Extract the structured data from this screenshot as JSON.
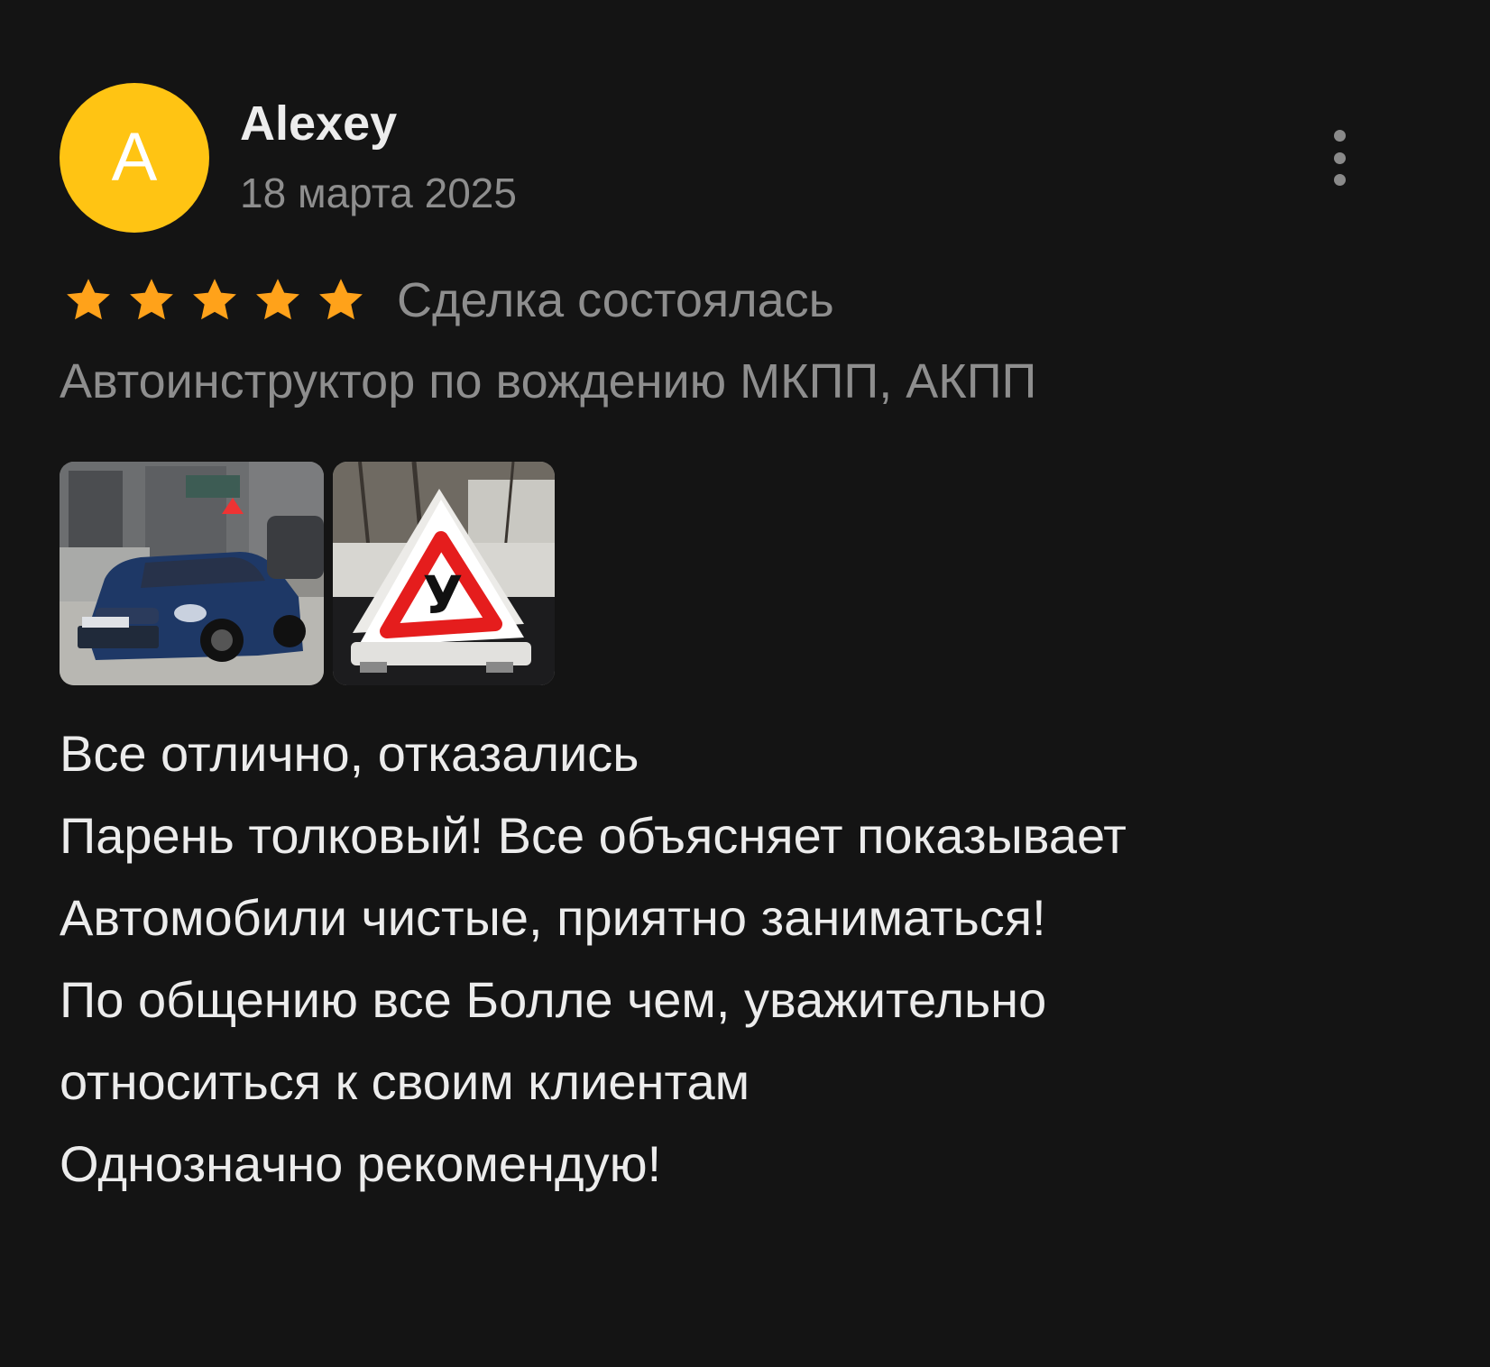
{
  "review": {
    "author": {
      "avatar_letter": "A",
      "avatar_color": "#ffc413",
      "name": "Alexey"
    },
    "date": "18 марта 2025",
    "more_icon": "more-vertical-icon",
    "rating": {
      "stars": 5,
      "max": 5,
      "star_color": "#ffa21a"
    },
    "status": "Сделка состоялась",
    "service": "Автоинструктор по вождению МКПП, АКПП",
    "photos": [
      {
        "subject": "blue-sedan-car",
        "sign_letter": ""
      },
      {
        "subject": "student-driver-roof-sign",
        "sign_letter": "У"
      }
    ],
    "text_lines": [
      "Все отлично, отказались",
      "Парень толковый! Все объясняет показывает",
      "Автомобили чистые, приятно заниматься!",
      "По общению все Болле чем, уважительно",
      "относиться к своим клиентам",
      "Однозначно рекомендую!"
    ]
  }
}
